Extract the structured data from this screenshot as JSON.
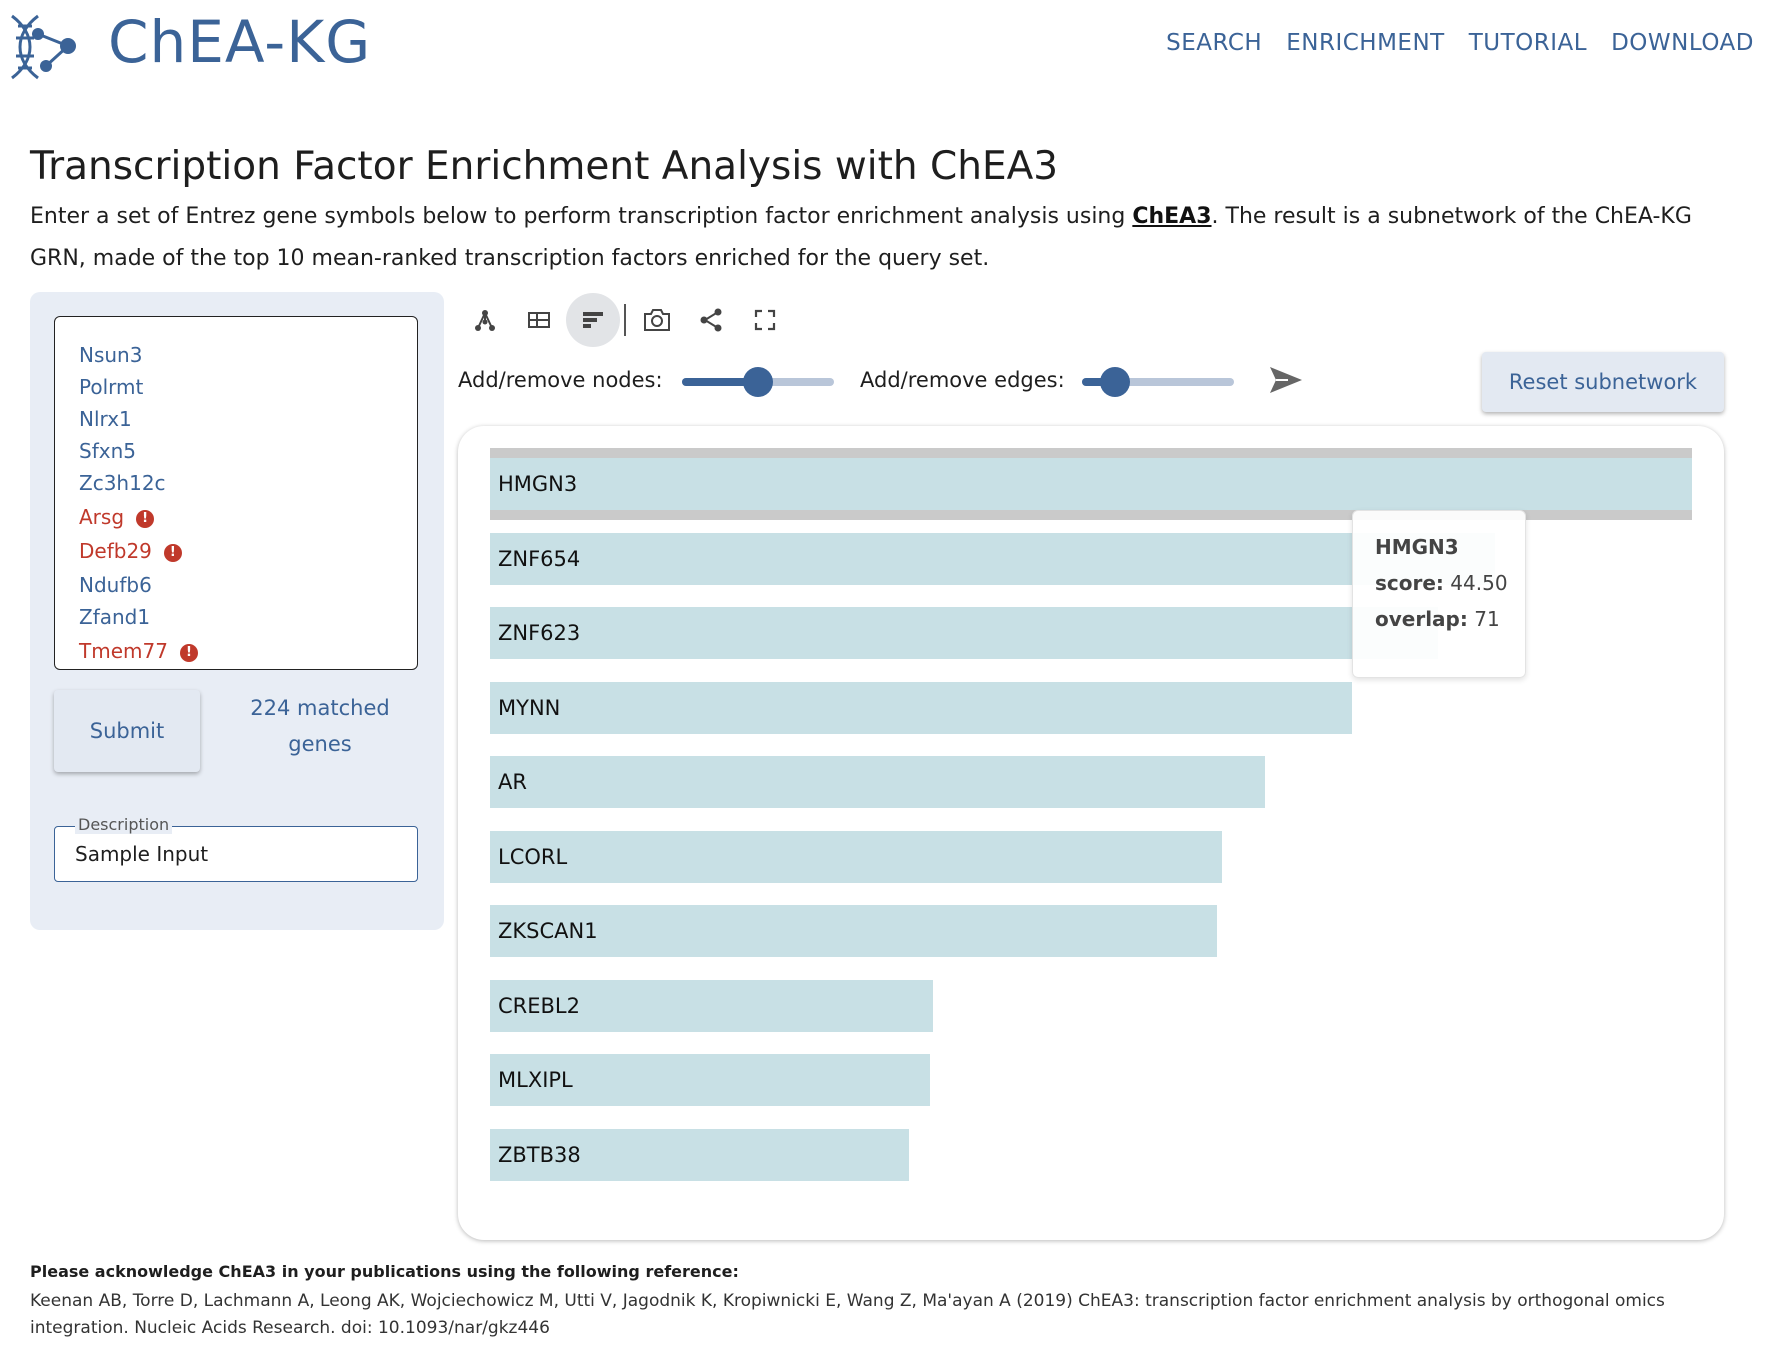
{
  "header": {
    "brand": "ChEA-KG",
    "nav": [
      "SEARCH",
      "ENRICHMENT",
      "TUTORIAL",
      "DOWNLOAD"
    ]
  },
  "page": {
    "title": "Transcription Factor Enrichment Analysis with ChEA3",
    "intro_before": "Enter a set of Entrez gene symbols below to perform transcription factor enrichment analysis using ",
    "intro_link": "ChEA3",
    "intro_after": ". The result is a subnetwork of the ChEA-KG GRN, made of the top 10 mean-ranked transcription factors enriched for the query set."
  },
  "input": {
    "genes": [
      {
        "symbol": "Nsun3",
        "valid": true
      },
      {
        "symbol": "Polrmt",
        "valid": true
      },
      {
        "symbol": "Nlrx1",
        "valid": true
      },
      {
        "symbol": "Sfxn5",
        "valid": true
      },
      {
        "symbol": "Zc3h12c",
        "valid": true
      },
      {
        "symbol": "Arsg",
        "valid": false
      },
      {
        "symbol": "Defb29",
        "valid": false
      },
      {
        "symbol": "Ndufb6",
        "valid": true
      },
      {
        "symbol": "Zfand1",
        "valid": true
      },
      {
        "symbol": "Tmem77",
        "valid": false
      }
    ],
    "submit_label": "Submit",
    "matched_label": "224 matched genes",
    "description_label": "Description",
    "description_value": "Sample Input"
  },
  "toolbar": {
    "icons": [
      "network-view-icon",
      "table-view-icon",
      "bar-chart-view-icon",
      "camera-icon",
      "share-icon",
      "fullscreen-icon"
    ],
    "active_view": "bar-chart-view-icon",
    "nodes_label": "Add/remove nodes:",
    "nodes_value": 0.5,
    "edges_label": "Add/remove edges:",
    "edges_value": 0.22,
    "reset_label": "Reset subnetwork"
  },
  "chart_data": {
    "type": "bar",
    "orientation": "horizontal",
    "categories": [
      "HMGN3",
      "ZNF654",
      "ZNF623",
      "MYNN",
      "AR",
      "LCORL",
      "ZKSCAN1",
      "CREBL2",
      "MLXIPL",
      "ZBTB38"
    ],
    "values": [
      44.5,
      37.2,
      35.1,
      31.9,
      28.7,
      27.1,
      26.9,
      16.4,
      16.3,
      15.5
    ],
    "value_field": "score",
    "selected": "HMGN3"
  },
  "tooltip": {
    "name": "HMGN3",
    "score_label": "score:",
    "score": "44.50",
    "overlap_label": "overlap:",
    "overlap": "71"
  },
  "acknowledgement": {
    "title": "Please acknowledge ChEA3 in your publications using the following reference:",
    "text": "Keenan AB, Torre D, Lachmann A, Leong AK, Wojciechowicz M, Utti V, Jagodnik K, Kropiwnicki E, Wang Z, Ma'ayan A (2019) ChEA3: transcription factor enrichment analysis by orthogonal omics integration. Nucleic Acids Research. doi: 10.1093/nar/gkz446"
  },
  "colors": {
    "brand": "#3b6397",
    "bar": "#c8e0e5",
    "warning": "#c0392b"
  }
}
